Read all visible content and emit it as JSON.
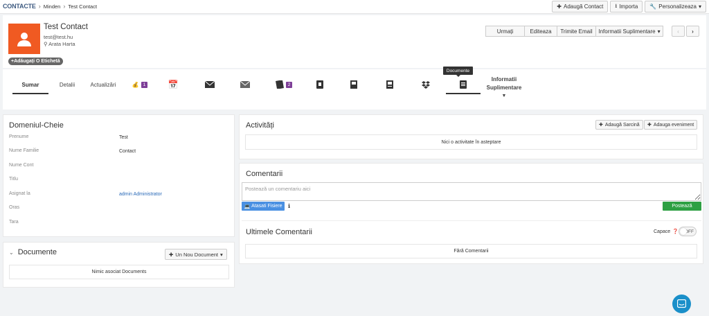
{
  "breadcrumb": {
    "root": "CONTACTE",
    "items": [
      "Minden",
      "Test Contact"
    ]
  },
  "topbar": {
    "add_contact": "Adaugă Contact",
    "import": "Importa",
    "customize": "Personalizeaza"
  },
  "contact": {
    "name": "Test Contact",
    "email": "test@test.hu",
    "map_link": "Arata Harta",
    "add_tag": "Adăugați O Etichetă"
  },
  "actions": {
    "follow": "Urmați",
    "edit": "Editeaza",
    "send_email": "Trimite Email",
    "extra_info": "Informatii Suplimentare"
  },
  "tabs": {
    "summary": "Sumar",
    "details": "Detalii",
    "updates": "Actualizări",
    "deals_count": "1",
    "quotes_count": "2",
    "more_info_line1": "Informatii",
    "more_info_line2": "Suplimentare",
    "tooltip": "Documente"
  },
  "key_fields": {
    "title": "Domeniul-Cheie",
    "rows": [
      {
        "label": "Prenume",
        "value": "Test"
      },
      {
        "label": "Nume Familie",
        "value": "Contact"
      },
      {
        "label": "Nume Cont",
        "value": ""
      },
      {
        "label": "Titlu",
        "value": ""
      },
      {
        "label": "Asignat la",
        "value": "admin Administrator"
      },
      {
        "label": "Oras",
        "value": ""
      },
      {
        "label": "Tara",
        "value": ""
      }
    ]
  },
  "documents": {
    "title": "Documente",
    "new_button": "Un Nou Document",
    "empty": "Nimic asociat Documents"
  },
  "activities": {
    "title": "Activități",
    "add_task": "Adaugă Sarcină",
    "add_event": "Adauga eveniment",
    "empty": "Nici o activitate în asteptare"
  },
  "comments": {
    "title": "Comentarii",
    "placeholder": "Postează un comentariu aici",
    "attach": "Atasati Fisiere",
    "post": "Postează",
    "latest_title": "Ultimele Comentarii",
    "caps_label": "Capace",
    "toggle_state": "OFF",
    "empty": "Fără Comentarii"
  },
  "colors": {
    "avatar": "#f05a22",
    "badge": "#7e3f98",
    "post": "#2ea043",
    "attach": "#4a90e2",
    "chat": "#1a8fc9"
  }
}
